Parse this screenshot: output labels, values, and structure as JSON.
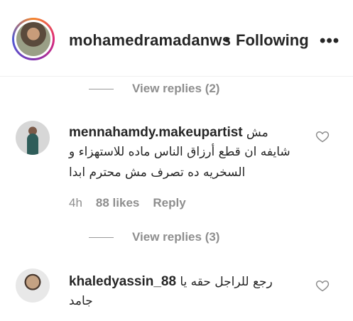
{
  "post_header": {
    "username": "mohamedramadanws",
    "separator": "•",
    "follow_status": "Following",
    "more_label": "•••"
  },
  "replies_toggle_1": {
    "label": "View replies (2)"
  },
  "comments": [
    {
      "username": "mennahamdy.makeupartist",
      "text_line1": "مش",
      "text_line2": "شايفه ان قطع أرزاق الناس ماده للاستهزاء و",
      "text_line3": "السخريه ده تصرف مش محترم ابدا",
      "time": "4h",
      "likes": "88 likes",
      "reply_label": "Reply"
    },
    {
      "username": "khaledyassin_88",
      "text_line1": "رجع للراجل حقه يا",
      "text_line2": "جامد"
    }
  ],
  "replies_toggle_2": {
    "label": "View replies (3)"
  },
  "icons": {
    "more": "more-horizontal-icon",
    "like": "heart-outline-icon"
  }
}
